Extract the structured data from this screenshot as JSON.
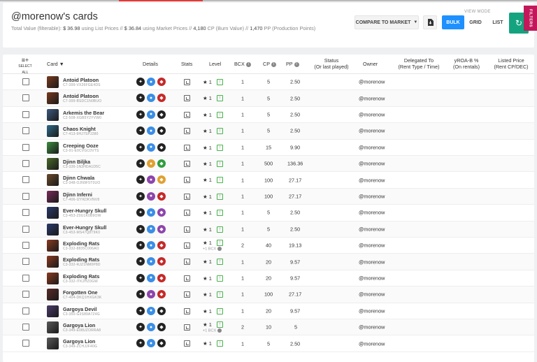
{
  "page": {
    "title": "@morenow's cards",
    "summary": {
      "prefix": "Total Value (filterable):",
      "list_value": "$ 36.98",
      "list_suffix": "using List Prices //",
      "market_value": "$ 36.84",
      "market_suffix": "using Market Prices //",
      "cp_value": "4,180",
      "cp_suffix": "CP (Burn Value) //",
      "pp_value": "1,470",
      "pp_suffix": "PP (Production Points)"
    }
  },
  "toolbar": {
    "compare_label": "COMPARE TO MARKET",
    "view_mode_label": "VIEW MODE",
    "view_modes": [
      "BULK",
      "GRID",
      "LIST"
    ],
    "active_view": "BULK",
    "filters_label": "FILTERS"
  },
  "table": {
    "headers": {
      "select_all": "SELECT ALL",
      "card": "Card",
      "details": "Details",
      "stats": "Stats",
      "level": "Level",
      "bcx": "BCX",
      "cp": "CP",
      "pp": "PP",
      "status": "Status",
      "status_sub": "(Or last played)",
      "owner": "Owner",
      "delegated": "Delegated To",
      "delegated_sub": "(Rent Type / Time)",
      "yroa": "yROA-B %",
      "yroa_sub": "(On rentals)",
      "listed": "Listed Price",
      "listed_sub": "(Rent CP/DEC)"
    },
    "rows": [
      {
        "name": "Antoid Platoon",
        "id": "C7-399-VX26FGE4DS",
        "level": "1",
        "bcx": "1",
        "cp": "5",
        "pp": "2.50",
        "owner": "@morenow",
        "extra": "",
        "color": "#7a3b1e",
        "icons": [
          "#222",
          "#3a8ee6",
          "#c62828"
        ]
      },
      {
        "name": "Antoid Platoon",
        "id": "C7-399-BSDC1N0BUO",
        "level": "1",
        "bcx": "1",
        "cp": "5",
        "pp": "2.50",
        "owner": "@morenow",
        "extra": "",
        "color": "#7a3b1e",
        "icons": [
          "#222",
          "#3a8ee6",
          "#c62828"
        ]
      },
      {
        "name": "Arkemis the Bear",
        "id": "C2-508-XGB5Y2YVW0",
        "level": "1",
        "bcx": "1",
        "cp": "5",
        "pp": "2.50",
        "owner": "@morenow",
        "extra": "",
        "color": "#3d5a80",
        "icons": [
          "#222",
          "#3a8ee6",
          "#222"
        ]
      },
      {
        "name": "Chaos Knight",
        "id": "C7-413-9HJ7SPJ280",
        "level": "1",
        "bcx": "1",
        "cp": "5",
        "pp": "2.50",
        "owner": "@morenow",
        "extra": "",
        "color": "#2e6b8a",
        "icons": [
          "#222",
          "#3a8ee6",
          "#222"
        ]
      },
      {
        "name": "Creeping Ooze",
        "id": "C3-91-E0CVGC0VTS",
        "level": "1",
        "bcx": "1",
        "cp": "15",
        "pp": "9.90",
        "owner": "@morenow",
        "extra": "",
        "color": "#3e8e41",
        "icons": [
          "#222",
          "#3a8ee6",
          "#222"
        ]
      },
      {
        "name": "Djinn Biljka",
        "id": "C3-336-1N3HDA1D5C",
        "level": "1",
        "bcx": "1",
        "cp": "500",
        "pp": "136.36",
        "owner": "@morenow",
        "extra": "",
        "color": "#4a6b2a",
        "icons": [
          "#222",
          "#e0a030",
          "#2e9e3e"
        ]
      },
      {
        "name": "Djinn Chwala",
        "id": "C3-348-OJN9F5T0UO",
        "level": "1",
        "bcx": "1",
        "cp": "100",
        "pp": "27.17",
        "owner": "@morenow",
        "extra": "",
        "color": "#6b4a2a",
        "icons": [
          "#222",
          "#8e44ad",
          "#e0a030"
        ]
      },
      {
        "name": "Djinn Inferni",
        "id": "C7-406-I2YKDKVNV8",
        "level": "1",
        "bcx": "1",
        "cp": "100",
        "pp": "27.17",
        "owner": "@morenow",
        "extra": "",
        "color": "#7a2a5a",
        "icons": [
          "#222",
          "#8e44ad",
          "#c62828"
        ]
      },
      {
        "name": "Ever-Hungry Skull",
        "id": "C3-453-Z0U1K0B9OW",
        "level": "1",
        "bcx": "1",
        "cp": "5",
        "pp": "2.50",
        "owner": "@morenow",
        "extra": "",
        "color": "#2a3a6b",
        "icons": [
          "#222",
          "#3a8ee6",
          "#8e44ad"
        ]
      },
      {
        "name": "Ever-Hungry Skull",
        "id": "C3-453-MS47Q8T9K0",
        "level": "1",
        "bcx": "1",
        "cp": "5",
        "pp": "2.50",
        "owner": "@morenow",
        "extra": "",
        "color": "#2a3a6b",
        "icons": [
          "#222",
          "#3a8ee6",
          "#8e44ad"
        ]
      },
      {
        "name": "Exploding Rats",
        "id": "C3-332-8835C006AO",
        "level": "1",
        "bcx": "2",
        "cp": "40",
        "pp": "19.13",
        "owner": "@morenow",
        "extra": "+1 BCX",
        "color": "#8a3a1e",
        "icons": [
          "#222",
          "#3a8ee6",
          "#c62828"
        ]
      },
      {
        "name": "Exploding Rats",
        "id": "C3-332-RJZ1NM0P8D",
        "level": "1",
        "bcx": "1",
        "cp": "20",
        "pp": "9.57",
        "owner": "@morenow",
        "extra": "",
        "color": "#8a3a1e",
        "icons": [
          "#222",
          "#3a8ee6",
          "#c62828"
        ]
      },
      {
        "name": "Exploding Rats",
        "id": "C3-332-ITK2HZ0GW",
        "level": "1",
        "bcx": "1",
        "cp": "20",
        "pp": "9.57",
        "owner": "@morenow",
        "extra": "",
        "color": "#8a3a1e",
        "icons": [
          "#222",
          "#3a8ee6",
          "#c62828"
        ]
      },
      {
        "name": "Forgotten One",
        "id": "C7-404-DKQ1HXGK3K",
        "level": "1",
        "bcx": "1",
        "cp": "100",
        "pp": "27.17",
        "owner": "@morenow",
        "extra": "",
        "color": "#5a2a2a",
        "icons": [
          "#222",
          "#8e44ad",
          "#c62828"
        ]
      },
      {
        "name": "Gargoya Devil",
        "id": "C3-350-G3S89A7Z4G",
        "level": "1",
        "bcx": "1",
        "cp": "20",
        "pp": "9.57",
        "owner": "@morenow",
        "extra": "",
        "color": "#4a3a6b",
        "icons": [
          "#222",
          "#3a8ee6",
          "#222"
        ]
      },
      {
        "name": "Gargoya Lion",
        "id": "C3-349-E08UZORRA8",
        "level": "1",
        "bcx": "2",
        "cp": "10",
        "pp": "5",
        "owner": "@morenow",
        "extra": "+1 BCX",
        "color": "#5a5a5a",
        "icons": [
          "#222",
          "#3a8ee6",
          "#222"
        ]
      },
      {
        "name": "Gargoya Lion",
        "id": "C3-349-ZCHJJF40G",
        "level": "1",
        "bcx": "1",
        "cp": "5",
        "pp": "2.50",
        "owner": "@morenow",
        "extra": "",
        "color": "#5a5a5a",
        "icons": [
          "#222",
          "#3a8ee6",
          "#222"
        ]
      }
    ]
  },
  "colors": {
    "accent": "#1e90ff",
    "refresh": "#14a37f",
    "filters": "#c2185b"
  }
}
